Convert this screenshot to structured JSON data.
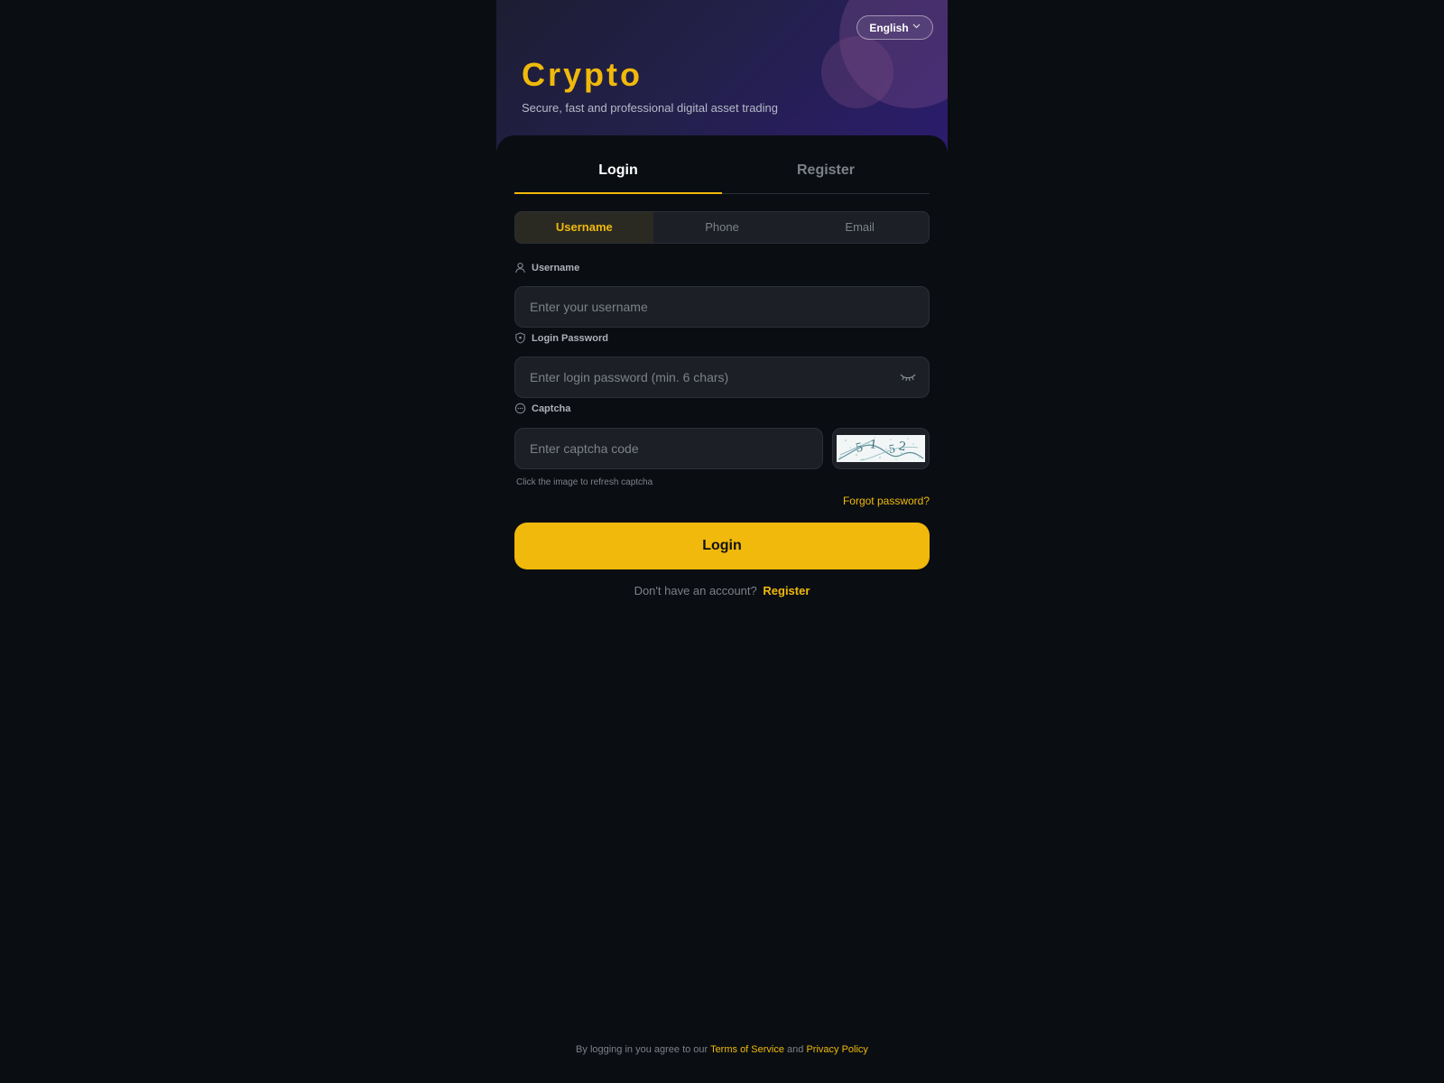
{
  "header": {
    "language": "English",
    "brand": "Crypto",
    "tagline": "Secure, fast and professional digital asset trading"
  },
  "tabs": [
    {
      "label": "Login",
      "active": true
    },
    {
      "label": "Register",
      "active": false
    }
  ],
  "methods": [
    {
      "label": "Username",
      "active": true
    },
    {
      "label": "Phone",
      "active": false
    },
    {
      "label": "Email",
      "active": false
    }
  ],
  "form": {
    "username": {
      "label": "Username",
      "placeholder": "Enter your username",
      "value": ""
    },
    "password": {
      "label": "Login Password",
      "placeholder": "Enter login password (min. 6 chars)",
      "value": ""
    },
    "captcha": {
      "label": "Captcha",
      "placeholder": "Enter captcha code",
      "value": "",
      "hint": "Click the image to refresh captcha"
    },
    "forgot": "Forgot password?",
    "submit": "Login"
  },
  "signup": {
    "text": "Don't have an account?",
    "link": "Register"
  },
  "footer": {
    "prefix": "By logging in you agree to our",
    "terms": "Terms of Service",
    "and": "and",
    "privacy": "Privacy Policy"
  },
  "colors": {
    "accent": "#f0b90b",
    "background": "#0a0e12",
    "surface": "#1c1f26"
  }
}
